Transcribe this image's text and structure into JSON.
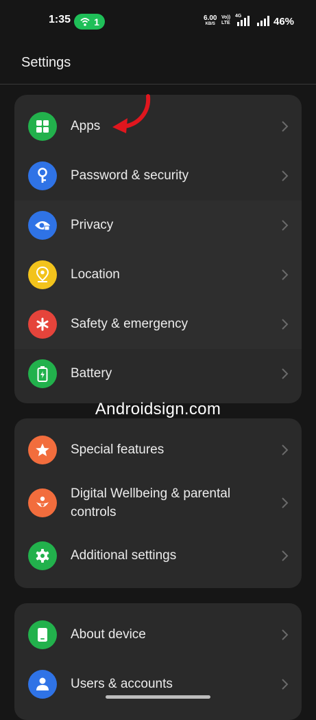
{
  "status_bar": {
    "time": "1:35",
    "hotspot_count": "1",
    "speed_value": "6.00",
    "speed_unit": "KB/S",
    "volte_top": "Vo))",
    "volte_bottom": "LTE",
    "network": "4G",
    "battery": "46%"
  },
  "header": {
    "title": "Settings"
  },
  "group1": [
    {
      "label": "Apps",
      "icon": "apps-icon",
      "color": "#22b14c"
    },
    {
      "label": "Password & security",
      "icon": "key-icon",
      "color": "#2f73e6"
    },
    {
      "label": "Privacy",
      "icon": "privacy-eye-icon",
      "color": "#2f73e6"
    },
    {
      "label": "Location",
      "icon": "location-pin-icon",
      "color": "#f2c31c"
    },
    {
      "label": "Safety & emergency",
      "icon": "asterisk-icon",
      "color": "#e5443b"
    },
    {
      "label": "Battery",
      "icon": "battery-icon",
      "color": "#22b14c"
    }
  ],
  "watermark": "Androidsign.com",
  "group2": [
    {
      "label": "Special features",
      "icon": "star-icon",
      "color": "#f26d3d"
    },
    {
      "label_line1": "Digital Wellbeing & parental",
      "label_line2": "controls",
      "icon": "wellbeing-icon",
      "color": "#f26d3d"
    },
    {
      "label": "Additional settings",
      "icon": "gear-icon",
      "color": "#22b14c"
    }
  ],
  "group3": [
    {
      "label": "About device",
      "icon": "phone-icon",
      "color": "#22b14c"
    },
    {
      "label": "Users & accounts",
      "icon": "user-icon",
      "color": "#2f73e6"
    }
  ],
  "annotation": {
    "arrow_color": "#e0161e"
  }
}
